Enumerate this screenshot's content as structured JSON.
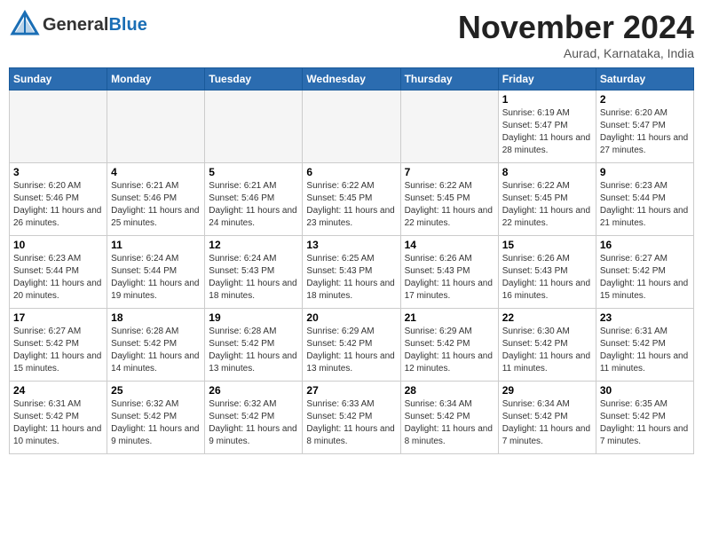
{
  "header": {
    "logo_general": "General",
    "logo_blue": "Blue",
    "month_title": "November 2024",
    "location": "Aurad, Karnataka, India"
  },
  "weekdays": [
    "Sunday",
    "Monday",
    "Tuesday",
    "Wednesday",
    "Thursday",
    "Friday",
    "Saturday"
  ],
  "weeks": [
    [
      {
        "day": "",
        "info": ""
      },
      {
        "day": "",
        "info": ""
      },
      {
        "day": "",
        "info": ""
      },
      {
        "day": "",
        "info": ""
      },
      {
        "day": "",
        "info": ""
      },
      {
        "day": "1",
        "info": "Sunrise: 6:19 AM\nSunset: 5:47 PM\nDaylight: 11 hours\nand 28 minutes."
      },
      {
        "day": "2",
        "info": "Sunrise: 6:20 AM\nSunset: 5:47 PM\nDaylight: 11 hours\nand 27 minutes."
      }
    ],
    [
      {
        "day": "3",
        "info": "Sunrise: 6:20 AM\nSunset: 5:46 PM\nDaylight: 11 hours\nand 26 minutes."
      },
      {
        "day": "4",
        "info": "Sunrise: 6:21 AM\nSunset: 5:46 PM\nDaylight: 11 hours\nand 25 minutes."
      },
      {
        "day": "5",
        "info": "Sunrise: 6:21 AM\nSunset: 5:46 PM\nDaylight: 11 hours\nand 24 minutes."
      },
      {
        "day": "6",
        "info": "Sunrise: 6:22 AM\nSunset: 5:45 PM\nDaylight: 11 hours\nand 23 minutes."
      },
      {
        "day": "7",
        "info": "Sunrise: 6:22 AM\nSunset: 5:45 PM\nDaylight: 11 hours\nand 22 minutes."
      },
      {
        "day": "8",
        "info": "Sunrise: 6:22 AM\nSunset: 5:45 PM\nDaylight: 11 hours\nand 22 minutes."
      },
      {
        "day": "9",
        "info": "Sunrise: 6:23 AM\nSunset: 5:44 PM\nDaylight: 11 hours\nand 21 minutes."
      }
    ],
    [
      {
        "day": "10",
        "info": "Sunrise: 6:23 AM\nSunset: 5:44 PM\nDaylight: 11 hours\nand 20 minutes."
      },
      {
        "day": "11",
        "info": "Sunrise: 6:24 AM\nSunset: 5:44 PM\nDaylight: 11 hours\nand 19 minutes."
      },
      {
        "day": "12",
        "info": "Sunrise: 6:24 AM\nSunset: 5:43 PM\nDaylight: 11 hours\nand 18 minutes."
      },
      {
        "day": "13",
        "info": "Sunrise: 6:25 AM\nSunset: 5:43 PM\nDaylight: 11 hours\nand 18 minutes."
      },
      {
        "day": "14",
        "info": "Sunrise: 6:26 AM\nSunset: 5:43 PM\nDaylight: 11 hours\nand 17 minutes."
      },
      {
        "day": "15",
        "info": "Sunrise: 6:26 AM\nSunset: 5:43 PM\nDaylight: 11 hours\nand 16 minutes."
      },
      {
        "day": "16",
        "info": "Sunrise: 6:27 AM\nSunset: 5:42 PM\nDaylight: 11 hours\nand 15 minutes."
      }
    ],
    [
      {
        "day": "17",
        "info": "Sunrise: 6:27 AM\nSunset: 5:42 PM\nDaylight: 11 hours\nand 15 minutes."
      },
      {
        "day": "18",
        "info": "Sunrise: 6:28 AM\nSunset: 5:42 PM\nDaylight: 11 hours\nand 14 minutes."
      },
      {
        "day": "19",
        "info": "Sunrise: 6:28 AM\nSunset: 5:42 PM\nDaylight: 11 hours\nand 13 minutes."
      },
      {
        "day": "20",
        "info": "Sunrise: 6:29 AM\nSunset: 5:42 PM\nDaylight: 11 hours\nand 13 minutes."
      },
      {
        "day": "21",
        "info": "Sunrise: 6:29 AM\nSunset: 5:42 PM\nDaylight: 11 hours\nand 12 minutes."
      },
      {
        "day": "22",
        "info": "Sunrise: 6:30 AM\nSunset: 5:42 PM\nDaylight: 11 hours\nand 11 minutes."
      },
      {
        "day": "23",
        "info": "Sunrise: 6:31 AM\nSunset: 5:42 PM\nDaylight: 11 hours\nand 11 minutes."
      }
    ],
    [
      {
        "day": "24",
        "info": "Sunrise: 6:31 AM\nSunset: 5:42 PM\nDaylight: 11 hours\nand 10 minutes."
      },
      {
        "day": "25",
        "info": "Sunrise: 6:32 AM\nSunset: 5:42 PM\nDaylight: 11 hours\nand 9 minutes."
      },
      {
        "day": "26",
        "info": "Sunrise: 6:32 AM\nSunset: 5:42 PM\nDaylight: 11 hours\nand 9 minutes."
      },
      {
        "day": "27",
        "info": "Sunrise: 6:33 AM\nSunset: 5:42 PM\nDaylight: 11 hours\nand 8 minutes."
      },
      {
        "day": "28",
        "info": "Sunrise: 6:34 AM\nSunset: 5:42 PM\nDaylight: 11 hours\nand 8 minutes."
      },
      {
        "day": "29",
        "info": "Sunrise: 6:34 AM\nSunset: 5:42 PM\nDaylight: 11 hours\nand 7 minutes."
      },
      {
        "day": "30",
        "info": "Sunrise: 6:35 AM\nSunset: 5:42 PM\nDaylight: 11 hours\nand 7 minutes."
      }
    ]
  ]
}
